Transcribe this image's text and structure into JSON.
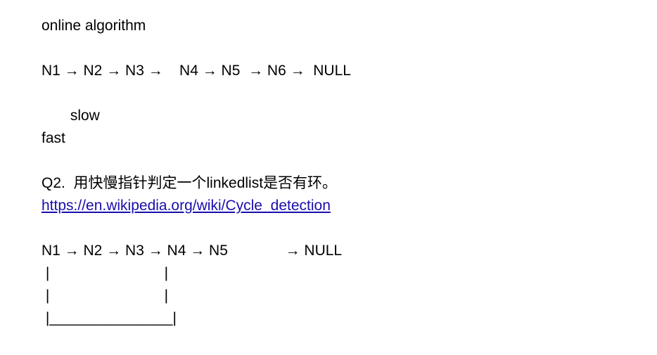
{
  "doc": {
    "heading": "online algorithm",
    "list1": "N1 → N2 → N3 →    N4 → N5  → N6 →  NULL",
    "slow_label": "       slow",
    "fast_label": "fast",
    "question": "Q2.  用快慢指针判定一个linkedlist是否有环。",
    "link_text": "https://en.wikipedia.org/wiki/Cycle_detection",
    "link_href": "https://en.wikipedia.org/wiki/Cycle_detection",
    "list2": "N1 → N2 → N3 → N4 → N5              → NULL",
    "loop_line1": " |                            |",
    "loop_line2": " |                            |",
    "loop_line3": " |_______________|"
  },
  "colors": {
    "text": "#000000",
    "link": "#1a0dab",
    "background": "#ffffff"
  }
}
